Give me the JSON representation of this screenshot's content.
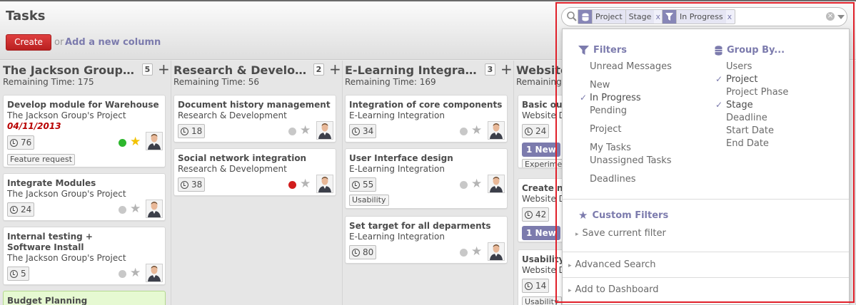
{
  "header": {
    "title": "Tasks",
    "create_label": "Create",
    "or_text": "or",
    "add_column_label": "Add a new column"
  },
  "search": {
    "facets": [
      {
        "icon": "group-by-icon",
        "values": [
          "Project",
          "Stage"
        ],
        "remove": "x"
      },
      {
        "icon": "filter-icon",
        "values": [
          "In Progress"
        ],
        "remove": "x"
      }
    ],
    "clear": "×"
  },
  "drawer": {
    "filters_title": "Filters",
    "filters": [
      {
        "label": "Unread Messages",
        "checked": false
      },
      {
        "label": "New",
        "checked": false
      },
      {
        "label": "In Progress",
        "checked": true
      },
      {
        "label": "Pending",
        "checked": false
      },
      {
        "label": "Project",
        "checked": false
      },
      {
        "label": "My Tasks",
        "checked": false
      },
      {
        "label": "Unassigned Tasks",
        "checked": false
      },
      {
        "label": "Deadlines",
        "checked": false
      }
    ],
    "groupby_title": "Group By...",
    "groupby": [
      {
        "label": "Users",
        "checked": false
      },
      {
        "label": "Project",
        "checked": true
      },
      {
        "label": "Project Phase",
        "checked": false
      },
      {
        "label": "Stage",
        "checked": true
      },
      {
        "label": "Deadline",
        "checked": false
      },
      {
        "label": "Start Date",
        "checked": false
      },
      {
        "label": "End Date",
        "checked": false
      }
    ],
    "custom_filters_title": "Custom Filters",
    "save_filter": "Save current filter",
    "advanced_search": "Advanced Search",
    "add_dashboard": "Add to Dashboard",
    "check_glyph": "✓",
    "arrow_glyph": "▸"
  },
  "columns": [
    {
      "title": "The Jackson Group's Project",
      "count": "5",
      "add": "+",
      "remaining": "Remaining Time: 175",
      "cards": [
        {
          "title": "Develop module for Warehouse",
          "project": "The Jackson Group's Project",
          "date": "04/11/2013",
          "hours": "76",
          "status": "green",
          "starred": true,
          "tag": "Feature request"
        },
        {
          "title": "Integrate Modules",
          "project": "The Jackson Group's Project",
          "hours": "24",
          "status": "grey",
          "starred": false
        },
        {
          "title": "Internal testing + Software Install",
          "project": "The Jackson Group's Project",
          "hours": "5",
          "status": "grey",
          "starred": false
        },
        {
          "title": "Budget Planning"
        }
      ]
    },
    {
      "title": "Research & Development",
      "count": "2",
      "add": "+",
      "remaining": "Remaining Time: 56",
      "cards": [
        {
          "title": "Document history management",
          "project": "Research & Development",
          "hours": "18",
          "status": "grey",
          "starred": false
        },
        {
          "title": "Social network integration",
          "project": "Research & Development",
          "hours": "38",
          "status": "red",
          "starred": false
        }
      ]
    },
    {
      "title": "E-Learning Integration",
      "count": "3",
      "add": "+",
      "remaining": "Remaining Time: 169",
      "cards": [
        {
          "title": "Integration of core components",
          "project": "E-Learning Integration",
          "hours": "34",
          "status": "grey",
          "starred": false
        },
        {
          "title": "User Interface design",
          "project": "E-Learning Integration",
          "hours": "55",
          "status": "grey",
          "starred": false,
          "tag": "Usability"
        },
        {
          "title": "Set target for all deparments",
          "project": "E-Learning Integration",
          "hours": "80",
          "status": "grey",
          "starred": false
        }
      ]
    },
    {
      "title": "Website",
      "remaining": "Remaining",
      "cards": [
        {
          "title": "Basic out",
          "project": "Website D",
          "hours": "24",
          "newmsg": "1 New",
          "tag": "Experiment"
        },
        {
          "title": "Create ne",
          "project": "Website D",
          "hours": "42",
          "newmsg": "1 New"
        },
        {
          "title": "Usability",
          "project": "Website D",
          "hours": "14",
          "tag": "Usability"
        }
      ]
    }
  ],
  "colors": {
    "accent": "#7c7bad",
    "create_button": "#c92a2a",
    "highlight": "#e0202a",
    "status_green": "#2db72d",
    "status_red": "#d11d1d",
    "status_grey": "#c8c8c8",
    "star_gold": "#f2c200",
    "date_red": "#b80000",
    "budget_card": "#e6f9d2"
  }
}
